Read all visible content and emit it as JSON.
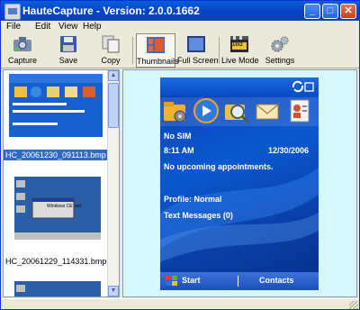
{
  "window": {
    "title": "HauteCapture - Version: 2.0.0.1662"
  },
  "menu": [
    "File",
    "Edit",
    "View",
    "Help"
  ],
  "toolbar": {
    "capture": "Capture",
    "save": "Save",
    "copy": "Copy",
    "thumbnails": "Thumbnails",
    "fullscreen": "Full Screen",
    "livemode": "Live Mode",
    "livemode_badge": "10/2",
    "settings": "Settings"
  },
  "thumbnails": [
    {
      "label": "HC_20061230_091113.bmp",
      "selected": true
    },
    {
      "label": "HC_20061229_114331.bmp",
      "selected": false,
      "caption": "Windows CE .net"
    }
  ],
  "phone": {
    "no_sim": "No SIM",
    "time": "8:11 AM",
    "date": "12/30/2006",
    "appointments": "No upcoming appointments.",
    "profile": "Profile: Normal",
    "messages": "Text Messages (0)",
    "soft_left": "Start",
    "soft_right": "Contacts"
  },
  "colors": {
    "titlebar": "#0a5fd8",
    "selection": "#316ac5",
    "preview_bg": "#d7f7fd",
    "phone_blue": "#0b58d0"
  }
}
